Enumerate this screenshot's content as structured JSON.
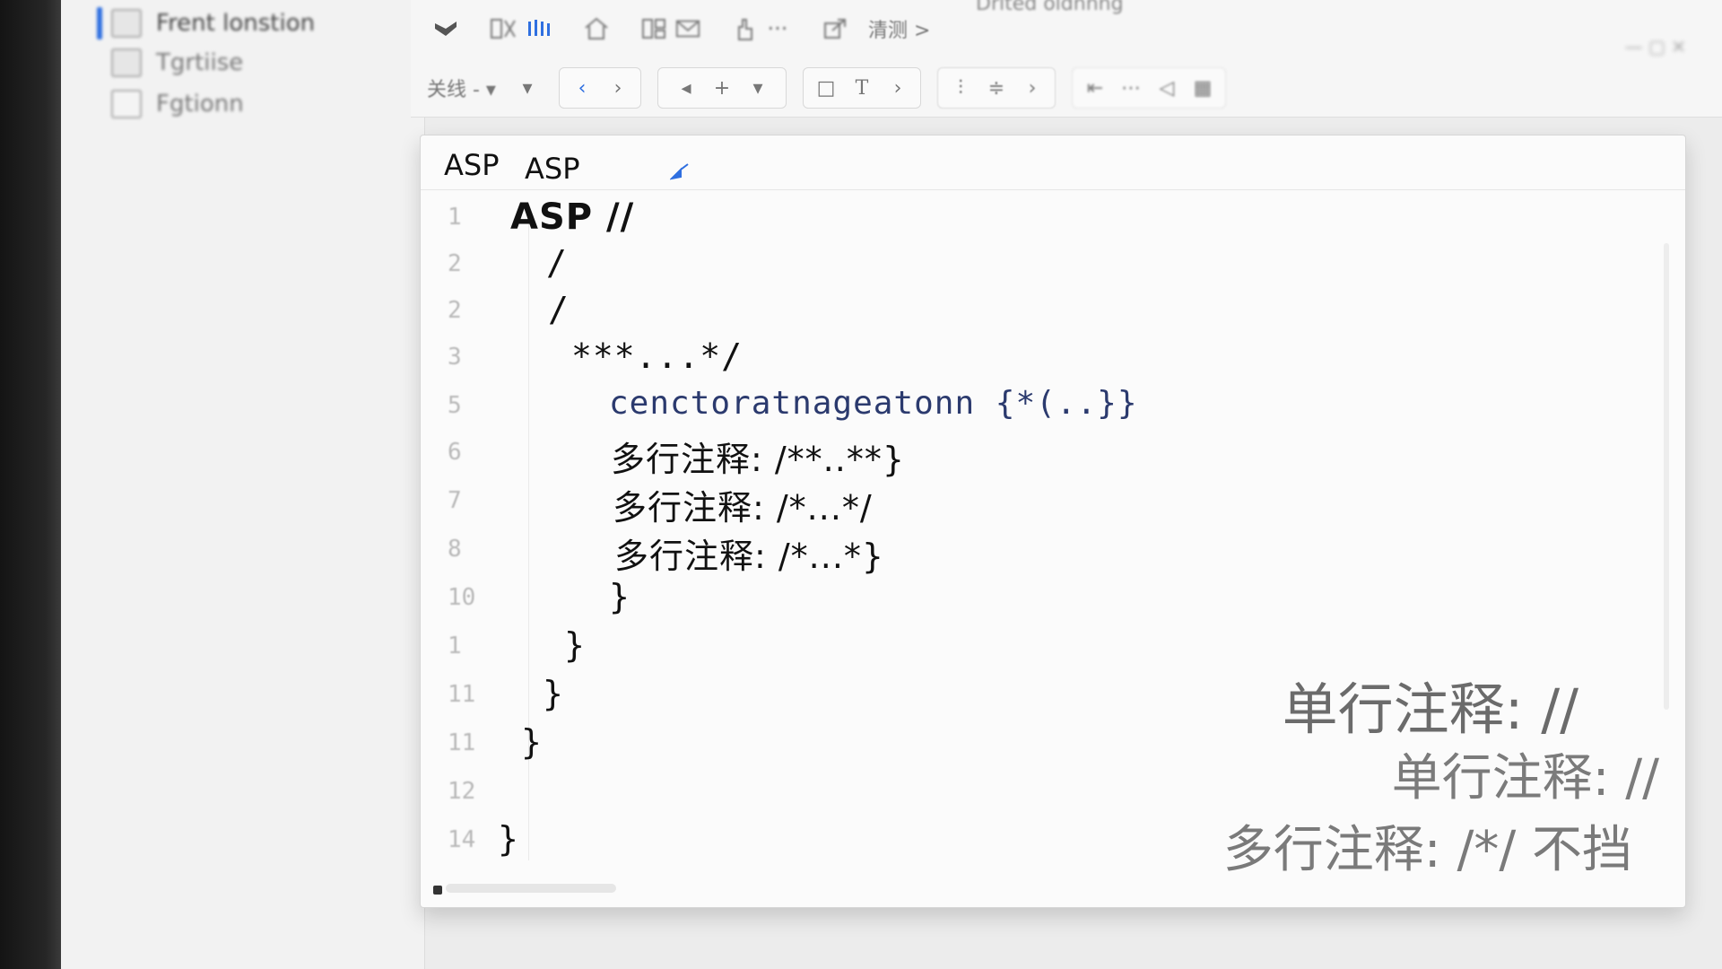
{
  "app": {
    "title_blurred": "Drlted oldnnng"
  },
  "sidebar": {
    "items": [
      {
        "label": "Frent lonstion",
        "active": true
      },
      {
        "label": "Tgrtiise",
        "active": false
      },
      {
        "label": "Fgtionn",
        "active": false
      }
    ]
  },
  "toolbar": {
    "row1_icons": [
      "bookmark-icon",
      "format-icon",
      "bars-icon",
      "home-icon",
      "layout-icon",
      "mail-icon",
      "hand-icon",
      "more-icon",
      "export-icon"
    ],
    "row1_label": "清测 >",
    "row2_dropdown_label": "关线 - ▾",
    "row2_icons": [
      "back-icon",
      "forward-icon",
      "prev-icon",
      "add-icon",
      "dropdown-icon",
      "box-icon",
      "text-icon",
      "next-icon",
      "align-icon",
      "distribute-icon",
      "indent-icon",
      "outdent-icon",
      "misc-icon"
    ],
    "accent_color": "#2f6fe0"
  },
  "tabs": [
    {
      "label": "ASP"
    },
    {
      "label": "ASP"
    }
  ],
  "code_lines": [
    {
      "n": "1",
      "text": "ASP //"
    },
    {
      "n": "2",
      "text": "/"
    },
    {
      "n": "2",
      "text": "/"
    },
    {
      "n": "3",
      "text": "***...*/"
    },
    {
      "n": "5",
      "text": "cenctoratnageatonn {*(..}}"
    },
    {
      "n": "6",
      "text": "多行注释: /**..**}"
    },
    {
      "n": "7",
      "text": "多行注释: /*...*/"
    },
    {
      "n": "8",
      "text": "多行注释: /*...*}"
    },
    {
      "n": "10",
      "text": "}"
    },
    {
      "n": "1",
      "text": "}"
    },
    {
      "n": "11",
      "text": "}"
    },
    {
      "n": "11",
      "text": "}"
    },
    {
      "n": "12",
      "text": ""
    },
    {
      "n": "14",
      "text": "}"
    }
  ],
  "overlay": {
    "line1": "单行注释: //",
    "line2": "单行注释: //",
    "line3": "多行注释: /*/ 不挡"
  }
}
